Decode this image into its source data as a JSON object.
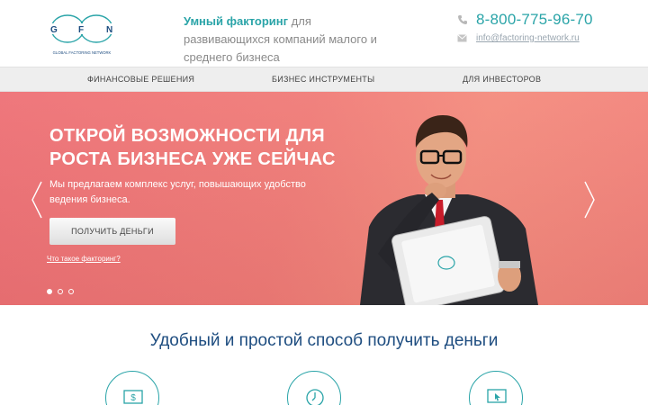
{
  "header": {
    "logo": {
      "letters": "G F N",
      "text": "GLOBAL FACTORING NETWORK"
    },
    "tagline_bold": "Умный факторинг",
    "tagline_rest": " для развивающихся компаний малого и среднего бизнеса",
    "phone_prefix": "8-800-",
    "phone_main": "775-96-70",
    "email": "info@factoring-network.ru"
  },
  "nav": {
    "items": [
      {
        "label": "ФИНАНСОВЫЕ РЕШЕНИЯ"
      },
      {
        "label": "БИЗНЕС ИНСТРУМЕНТЫ"
      },
      {
        "label": "ДЛЯ ИНВЕСТОРОВ"
      }
    ]
  },
  "hero": {
    "title_line1": "ОТКРОЙ ВОЗМОЖНОСТИ ДЛЯ",
    "title_line2": "РОСТА БИЗНЕСА УЖЕ СЕЙЧАС",
    "subtitle": "Мы предлагаем комплекс услуг, повышающих удобство ведения бизнеса.",
    "button_label": "ПОЛУЧИТЬ ДЕНЬГИ",
    "link_label": "Что такое факторинг?",
    "slides_total": 3,
    "active_slide": 1
  },
  "main": {
    "section_title": "Удобный и простой способ получить деньги",
    "feature_icons": [
      "money-icon",
      "clock-icon",
      "click-icon"
    ]
  },
  "colors": {
    "accent": "#2aa4a8",
    "hero": "#f07a76",
    "title": "#1e4d80"
  }
}
